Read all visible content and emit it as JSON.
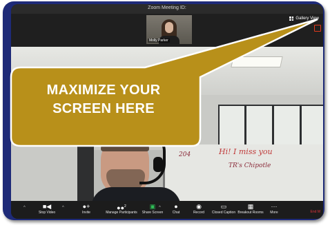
{
  "window": {
    "title": "Zoom Meeting ID:"
  },
  "gallery": {
    "label": "Gallery View"
  },
  "thumbnail": {
    "name": "Molly Parker"
  },
  "whiteboard": {
    "note1": "Hi! I miss you",
    "note2": "TR's Chipotle",
    "note3": "204"
  },
  "toolbar": {
    "items": [
      {
        "label": "Stop Video",
        "icon": "video-camera-icon"
      },
      {
        "label": "Invite",
        "icon": "invite-icon"
      },
      {
        "label": "Manage Participants",
        "icon": "participants-icon",
        "count": "2"
      },
      {
        "label": "Share Screen",
        "icon": "share-screen-icon"
      },
      {
        "label": "Chat",
        "icon": "chat-icon"
      },
      {
        "label": "Record",
        "icon": "record-icon"
      },
      {
        "label": "Closed Caption",
        "icon": "closed-caption-icon"
      },
      {
        "label": "Breakout Rooms",
        "icon": "breakout-rooms-icon"
      },
      {
        "label": "More",
        "icon": "more-icon"
      }
    ],
    "end_label": "End M"
  },
  "callout": {
    "line1": "MAXIMIZE YOUR",
    "line2": "SCREEN HERE",
    "fill": "#b8901a",
    "border": "#ffffff"
  },
  "colors": {
    "frame": "#1e2a78",
    "share_green": "#2fbf57",
    "end_red": "#e0343b",
    "highlight_red": "#e23a1c"
  }
}
